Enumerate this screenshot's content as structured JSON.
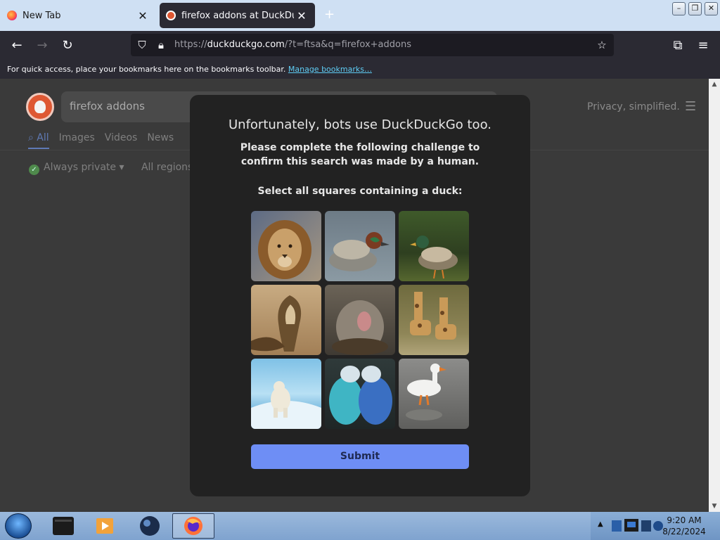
{
  "browser": {
    "tabs": [
      {
        "title": "New Tab",
        "active": false,
        "favicon": "firefox-icon"
      },
      {
        "title": "firefox addons at DuckDuckGo",
        "active": true,
        "favicon": "duckduckgo-icon"
      }
    ],
    "new_tab_symbol": "+",
    "close_symbol": "✕",
    "url": {
      "prefix": "https://",
      "host": "duckduckgo.com",
      "rest": "/?t=ftsa&q=firefox+addons"
    },
    "bookmarks_bar": {
      "message": "For quick access, place your bookmarks here on the bookmarks toolbar.",
      "link": "Manage bookmarks…"
    }
  },
  "ddg_header": {
    "search_value": "firefox addons",
    "tagline": "Privacy, simplified.",
    "nav_tabs": [
      "All",
      "Images",
      "Videos",
      "News"
    ],
    "filters": {
      "privacy": "Always private",
      "region": "All regions"
    }
  },
  "challenge": {
    "title": "Unfortunately, bots use DuckDuckGo too.",
    "subtitle": "Please complete the following challenge to confirm this search was made by a human.",
    "instruction": "Select all squares containing a duck:",
    "submit_label": "Submit",
    "tiles": [
      "lion",
      "duck",
      "duck",
      "cobra",
      "kangaroo",
      "giraffe",
      "polar-bear",
      "budgies",
      "duck"
    ]
  },
  "taskbar": {
    "time": "9:20 AM",
    "date": "8/22/2024"
  }
}
